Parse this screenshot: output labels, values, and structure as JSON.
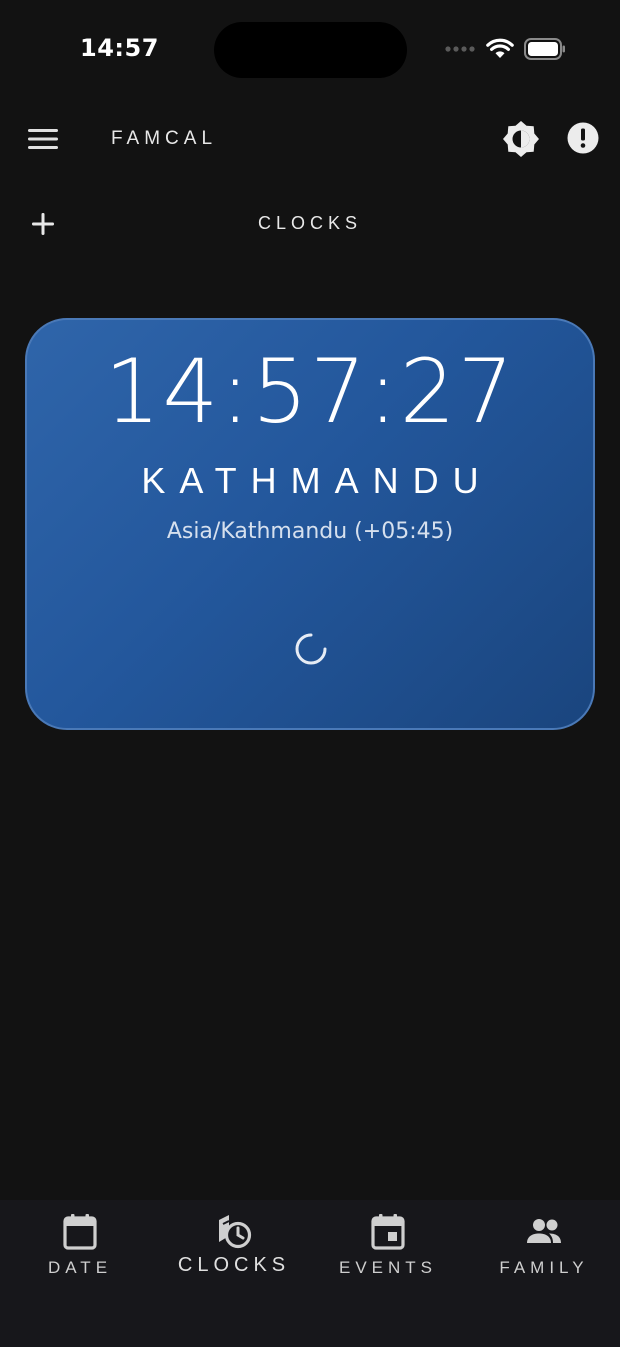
{
  "status_bar": {
    "time": "14:57",
    "icons": [
      "cellular-signal-icon",
      "wifi-icon",
      "battery-icon"
    ]
  },
  "app_bar": {
    "title": "FAMCAL",
    "icons": [
      "menu-icon",
      "theme-toggle-icon",
      "info-icon"
    ]
  },
  "page": {
    "title": "CLOCKS",
    "add_icon": "plus-icon"
  },
  "clocks": [
    {
      "time": "14:57:27",
      "city": "KATHMANDU",
      "zone": "Asia/Kathmandu (+05:45)",
      "status_icon": "loading-spinner-icon"
    }
  ],
  "bottom_nav": {
    "items": [
      {
        "label": "DATE",
        "icon": "calendar-icon"
      },
      {
        "label": "CLOCKS",
        "icon": "clock-icon",
        "active": true
      },
      {
        "label": "EVENTS",
        "icon": "event-icon"
      },
      {
        "label": "FAMILY",
        "icon": "people-icon"
      }
    ]
  },
  "colors": {
    "background": "#121212",
    "card_gradient_start": "#2f65aa",
    "card_gradient_end": "#1a457e",
    "card_border": "#4a79b7",
    "nav_background": "#17171b"
  }
}
